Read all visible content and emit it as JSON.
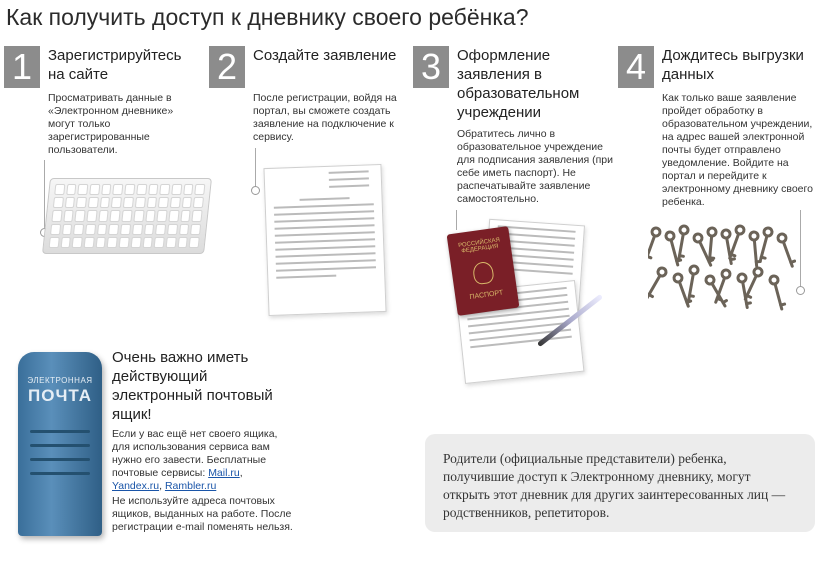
{
  "page": {
    "title": "Как получить доступ к дневнику своего ребёнка?"
  },
  "steps": [
    {
      "number": "1",
      "title": "Зарегистрируйтесь на сайте",
      "text": "Просматривать данные в «Электронном дневнике» могут только зарегистрированные пользователи."
    },
    {
      "number": "2",
      "title": "Создайте заявление",
      "text": "После регистрации, войдя на портал, вы сможете создать заявление на подключение к сервису."
    },
    {
      "number": "3",
      "title": "Оформление заявления в образовательном учреждении",
      "text": "Обратитесь лично в образовательное учреждение для подписания заявления (при себе иметь паспорт). Не распечатывайте заявление самостоятельно."
    },
    {
      "number": "4",
      "title": "Дождитесь выгрузки данных",
      "text": "Как только ваше заявление пройдет обработку в образовательном учреждении, на адрес вашей электронной почты будет отправлено уведомление. Войдите на портал и перейдите к электронному дневнику своего ребенка."
    }
  ],
  "images": {
    "mailbox_line1": "ЭЛЕКТРОННАЯ",
    "mailbox_line2": "ПОЧТА",
    "passport_line1": "РОССИЙСКАЯ ФЕДЕРАЦИЯ",
    "passport_line2": "ПАСПОРТ"
  },
  "mail": {
    "title": "Очень важно иметь действующий электронный почтовый ящик!",
    "text_intro": "Если у вас ещё нет своего ящика, для использования сервиса вам нужно его завести. Бесплатные почтовые сервисы: ",
    "link_mail": "Mail.ru",
    "sep1": ", ",
    "link_yandex": "Yandex.ru",
    "sep2": ", ",
    "link_rambler": "Rambler.ru",
    "warning": "Не используйте адреса почтовых ящиков, выданных на работе. После регистрации e-mail поменять нельзя."
  },
  "note": {
    "text": "Родители (официальные представители) ребенка, получившие доступ к Электронному дневнику, могут открыть этот дневник для других заинтересованных лиц — родственников, репетиторов."
  },
  "colors": {
    "number_bg": "#8c8c8c",
    "link": "#1a55a8",
    "note_bg": "#ececec",
    "mailbox": "#4a80ab"
  }
}
